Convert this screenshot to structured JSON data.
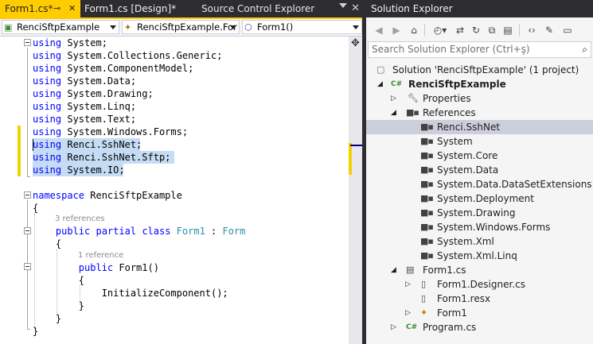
{
  "editor": {
    "tabs": [
      {
        "label": "Form1.cs*",
        "active": true
      },
      {
        "label": "Form1.cs [Design]*",
        "active": false
      },
      {
        "label": "Source Control Explorer",
        "active": false
      }
    ],
    "nav": {
      "project": "RenciSftpExample",
      "type": "RenciSftpExample.For",
      "member": "Form1()"
    },
    "code_lines": [
      [
        {
          "t": "using",
          "c": "kw"
        },
        {
          "t": " System;"
        }
      ],
      [
        {
          "t": "using",
          "c": "kw"
        },
        {
          "t": " System.Collections.Generic;"
        }
      ],
      [
        {
          "t": "using",
          "c": "kw"
        },
        {
          "t": " System.ComponentModel;"
        }
      ],
      [
        {
          "t": "using",
          "c": "kw"
        },
        {
          "t": " System.Data;"
        }
      ],
      [
        {
          "t": "using",
          "c": "kw"
        },
        {
          "t": " System.Drawing;"
        }
      ],
      [
        {
          "t": "using",
          "c": "kw"
        },
        {
          "t": " System.Linq;"
        }
      ],
      [
        {
          "t": "using",
          "c": "kw"
        },
        {
          "t": " System.Text;"
        }
      ],
      [
        {
          "t": "using",
          "c": "kw"
        },
        {
          "t": " System.Windows.Forms;"
        }
      ],
      [
        {
          "t": "using",
          "c": "kw"
        },
        {
          "t": " Renci.SshNet;"
        }
      ],
      [
        {
          "t": "using",
          "c": "kw"
        },
        {
          "t": " Renci.SshNet.Sftp;"
        }
      ],
      [
        {
          "t": "using",
          "c": "kw"
        },
        {
          "t": " System.IO;"
        }
      ],
      [],
      [
        {
          "t": "namespace",
          "c": "kw"
        },
        {
          "t": " RenciSftpExample"
        }
      ],
      [
        {
          "t": "{"
        }
      ],
      [
        {
          "t": "    "
        },
        {
          "t": "public",
          "c": "kw"
        },
        {
          "t": " "
        },
        {
          "t": "partial",
          "c": "kw"
        },
        {
          "t": " "
        },
        {
          "t": "class",
          "c": "kw"
        },
        {
          "t": " "
        },
        {
          "t": "Form1",
          "c": "ty"
        },
        {
          "t": " : "
        },
        {
          "t": "Form",
          "c": "ty"
        }
      ],
      [
        {
          "t": "    {"
        }
      ],
      [
        {
          "t": "        "
        },
        {
          "t": "public",
          "c": "kw"
        },
        {
          "t": " Form1()"
        }
      ],
      [
        {
          "t": "        {"
        }
      ],
      [
        {
          "t": "            InitializeComponent();"
        }
      ],
      [
        {
          "t": "        }"
        }
      ],
      [
        {
          "t": "    }"
        }
      ],
      [
        {
          "t": "}"
        }
      ]
    ],
    "code_lens": [
      {
        "text": "3 references"
      },
      {
        "text": "1 reference"
      }
    ]
  },
  "solution_explorer": {
    "title": "Solution Explorer",
    "search_placeholder": "Search Solution Explorer (Ctrl+ş)",
    "tree": [
      {
        "label": "Solution 'RenciSftpExample' (1 project)",
        "icon": "solution-icon"
      },
      {
        "label": "RenciSftpExample",
        "icon": "csharp-project-icon",
        "bold": true
      },
      {
        "label": "Properties",
        "icon": "wrench-icon"
      },
      {
        "label": "References",
        "icon": "references-icon"
      },
      {
        "label": "Renci.SshNet",
        "icon": "reference-icon",
        "selected": true
      },
      {
        "label": "System",
        "icon": "reference-icon"
      },
      {
        "label": "System.Core",
        "icon": "reference-icon"
      },
      {
        "label": "System.Data",
        "icon": "reference-icon"
      },
      {
        "label": "System.Data.DataSetExtensions",
        "icon": "reference-icon"
      },
      {
        "label": "System.Deployment",
        "icon": "reference-icon"
      },
      {
        "label": "System.Drawing",
        "icon": "reference-icon"
      },
      {
        "label": "System.Windows.Forms",
        "icon": "reference-icon"
      },
      {
        "label": "System.Xml",
        "icon": "reference-icon"
      },
      {
        "label": "System.Xml.Linq",
        "icon": "reference-icon"
      },
      {
        "label": "Form1.cs",
        "icon": "form-icon"
      },
      {
        "label": "Form1.Designer.cs",
        "icon": "csharp-file-icon"
      },
      {
        "label": "Form1.resx",
        "icon": "resource-file-icon"
      },
      {
        "label": "Form1",
        "icon": "class-icon"
      },
      {
        "label": "Program.cs",
        "icon": "csharp-file-icon"
      }
    ]
  },
  "colors": {
    "accent_tab": "#ffcc00",
    "selection": "#c5dcf4",
    "keyword": "#0000ff",
    "type": "#2b91af",
    "change_marker": "#efd400"
  }
}
